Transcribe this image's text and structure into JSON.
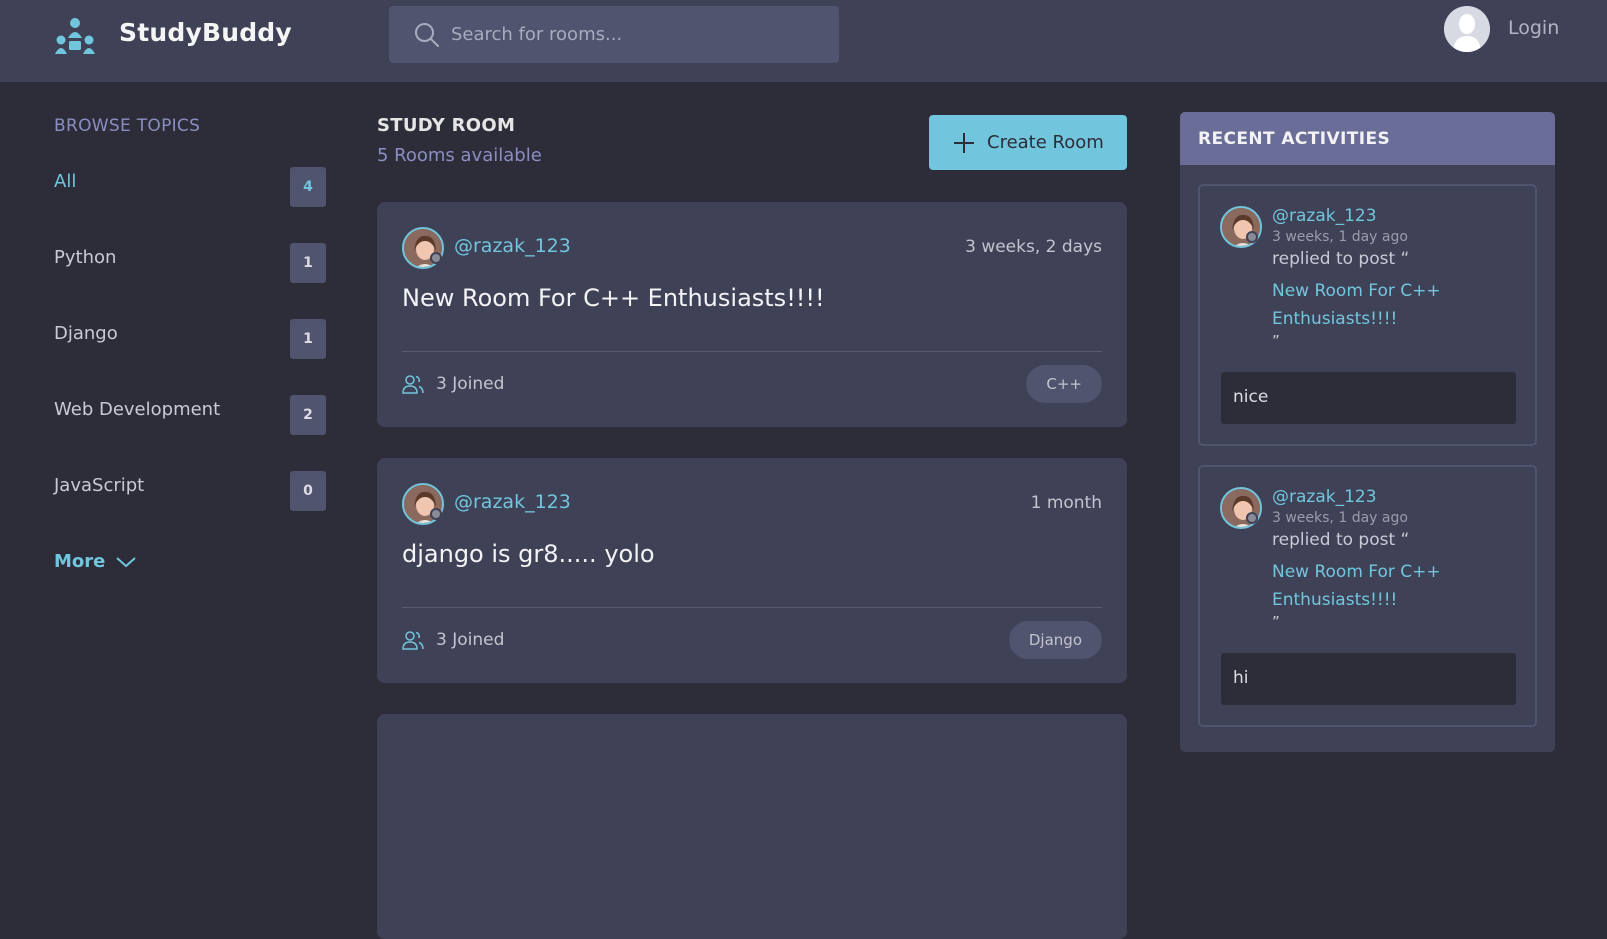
{
  "header": {
    "brand": "StudyBuddy",
    "search_placeholder": "Search for rooms...",
    "login_label": "Login"
  },
  "sidebar": {
    "title": "BROWSE TOPICS",
    "topics": [
      {
        "label": "All",
        "count": "4"
      },
      {
        "label": "Python",
        "count": "1"
      },
      {
        "label": "Django",
        "count": "1"
      },
      {
        "label": "Web Development",
        "count": "2"
      },
      {
        "label": "JavaScript",
        "count": "0"
      }
    ],
    "more_label": "More"
  },
  "main": {
    "heading": "STUDY ROOM",
    "subheading": "5 Rooms available",
    "create_label": "Create Room",
    "rooms": [
      {
        "host": "@razak_123",
        "time": "3 weeks, 2 days",
        "title": "New Room For C++ Enthusiasts!!!!",
        "joined": "3 Joined",
        "topic": "C++"
      },
      {
        "host": "@razak_123",
        "time": "1 month",
        "title": "django is gr8..... yolo",
        "joined": "3 Joined",
        "topic": "Django"
      }
    ]
  },
  "activity": {
    "title": "RECENT ACTIVITIES",
    "items": [
      {
        "user": "@razak_123",
        "time": "3 weeks, 1 day ago",
        "action": "replied to post “",
        "post": "New Room For C++ Enthusiasts!!!!",
        "close": "”",
        "message": "nice"
      },
      {
        "user": "@razak_123",
        "time": "3 weeks, 1 day ago",
        "action": "replied to post “",
        "post": "New Room For C++ Enthusiasts!!!!",
        "close": "”",
        "message": "hi"
      }
    ]
  },
  "colors": {
    "background": "#2d2d39",
    "header": "#3f4156",
    "card": "#3f4156",
    "accent": "#71c6dd",
    "muted_purple": "#8b8ec2",
    "activity_header": "#696d97"
  },
  "icons": {
    "logo": "studybuddy-logo-icon",
    "search": "search-icon",
    "avatar": "user-avatar-icon",
    "more": "chevron-down-icon",
    "create": "plus-icon",
    "joined": "users-icon"
  }
}
